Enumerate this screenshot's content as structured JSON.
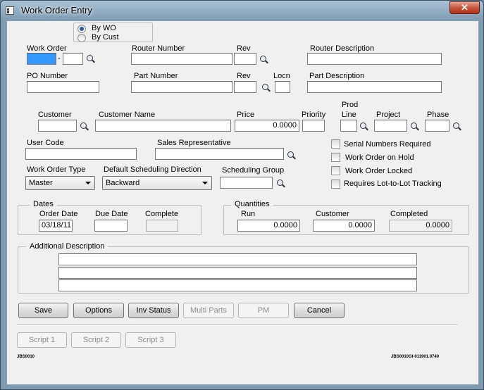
{
  "window": {
    "title": "Work Order Entry",
    "close_glyph": "✕"
  },
  "mode": {
    "options": [
      "By WO",
      "By Cust"
    ],
    "selected": "By WO"
  },
  "labels": {
    "work_order": "Work Order",
    "router_number": "Router Number",
    "rev": "Rev",
    "router_description": "Router Description",
    "po_number": "PO Number",
    "part_number": "Part Number",
    "part_rev": "Rev",
    "locn": "Locn",
    "part_description": "Part Description",
    "customer": "Customer",
    "customer_name": "Customer Name",
    "price": "Price",
    "priority": "Priority",
    "prod_line_1": "Prod",
    "prod_line_2": "Line",
    "project": "Project",
    "phase": "Phase",
    "user_code": "User Code",
    "sales_rep": "Sales Representative",
    "work_order_type": "Work Order Type",
    "default_sched_dir": "Default Scheduling Direction",
    "scheduling_group": "Scheduling Group",
    "wo_separator": "-"
  },
  "values": {
    "work_order": "",
    "work_order_suffix": "",
    "router_number": "",
    "rev": "",
    "router_description": "",
    "po_number": "",
    "part_number": "",
    "part_rev": "",
    "locn": "",
    "part_description": "",
    "customer": "",
    "customer_name": "",
    "price": "0.0000",
    "priority": "",
    "prod_line": "",
    "project": "",
    "phase": "",
    "user_code": "",
    "sales_rep": "",
    "scheduling_group": ""
  },
  "selects": {
    "work_order_type": "Master",
    "default_sched_dir": "Backward"
  },
  "checkboxes": [
    {
      "label": "Serial Numbers Required",
      "checked": false
    },
    {
      "label": "Work Order on Hold",
      "checked": false
    },
    {
      "label": "Work Order Locked",
      "checked": false
    },
    {
      "label": "Requires Lot-to-Lot Tracking",
      "checked": false
    }
  ],
  "dates": {
    "title": "Dates",
    "order_date_label": "Order Date",
    "due_date_label": "Due Date",
    "complete_label": "Complete",
    "order_date": "03/18/11",
    "due_date": "",
    "complete": ""
  },
  "quantities": {
    "title": "Quantities",
    "run_label": "Run",
    "customer_label": "Customer",
    "completed_label": "Completed",
    "run": "0.0000",
    "customer": "0.0000",
    "completed": "0.0000"
  },
  "additional": {
    "title": "Additional Description",
    "lines": [
      "",
      "",
      ""
    ]
  },
  "buttons": {
    "save": "Save",
    "options": "Options",
    "inv_status": "Inv Status",
    "multi_parts": "Multi Parts",
    "pm": "PM",
    "cancel": "Cancel",
    "script1": "Script 1",
    "script2": "Script 2",
    "script3": "Script 3"
  },
  "footer": {
    "left": "JBS0010",
    "right": "JBS0010GI-011901.0740"
  }
}
